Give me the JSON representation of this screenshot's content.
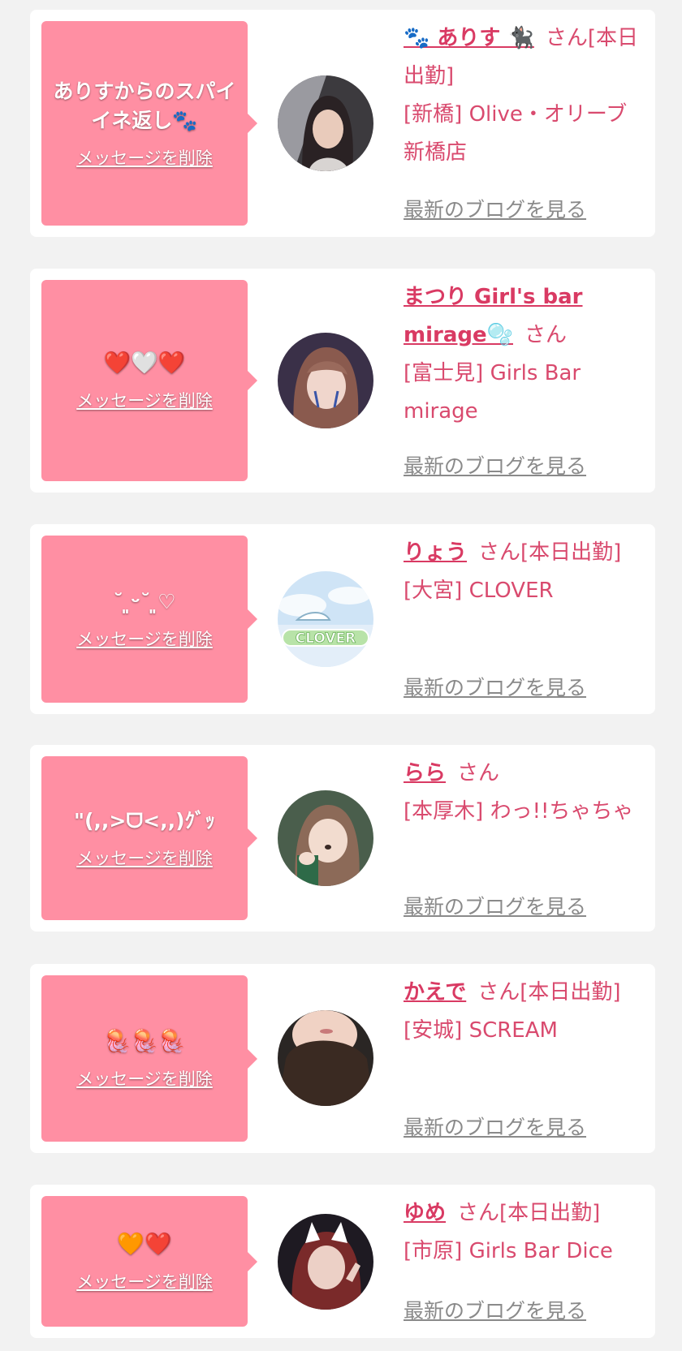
{
  "delete_label": "メッセージを削除",
  "blog_label": "最新のブログを見る",
  "honorific": "さん",
  "colors": {
    "bubble": "#ff8fa3",
    "name": "#d93a63",
    "text": "#d94a6e",
    "link": "#8a8a8a",
    "background": "#f2f2f2"
  },
  "messages": [
    {
      "message": "ありすからのスパイイネ返し🐾",
      "name": "🐾 ありす 🐈‍⬛",
      "status": "[本日出勤]",
      "area": "[新橋]",
      "shop": "Olive・オリーブ新橋店",
      "avatar_icon": "user-photo-avatar"
    },
    {
      "message": "❤️🤍❤️",
      "name": "まつり Girl's bar mirage🫧",
      "status": "",
      "area": "[富士見]",
      "shop": "Girls Bar mirage",
      "avatar_icon": "user-photo-avatar"
    },
    {
      "message": "˘ ͈ᵕ˘ ͈♡",
      "name": "りょう",
      "status": "[本日出勤]",
      "area": "[大宮]",
      "shop": "CLOVER",
      "avatar_icon": "clover-logo-avatar",
      "avatar_text": "CLOVER"
    },
    {
      "message": "\"(,,>ᗜ<,,)ｸﾞｯ",
      "name": "らら",
      "status": "",
      "area": "[本厚木]",
      "shop": "わっ!!ちゃちゃ",
      "avatar_icon": "user-photo-avatar"
    },
    {
      "message": "🪼🪼🪼",
      "name": "かえで",
      "status": "[本日出勤]",
      "area": "[安城]",
      "shop": "SCREAM",
      "avatar_icon": "user-photo-avatar"
    },
    {
      "message": "🧡❤️",
      "name": "ゆめ",
      "status": "[本日出勤]",
      "area": "[市原]",
      "shop": "Girls Bar Dice",
      "avatar_icon": "user-photo-avatar"
    }
  ]
}
